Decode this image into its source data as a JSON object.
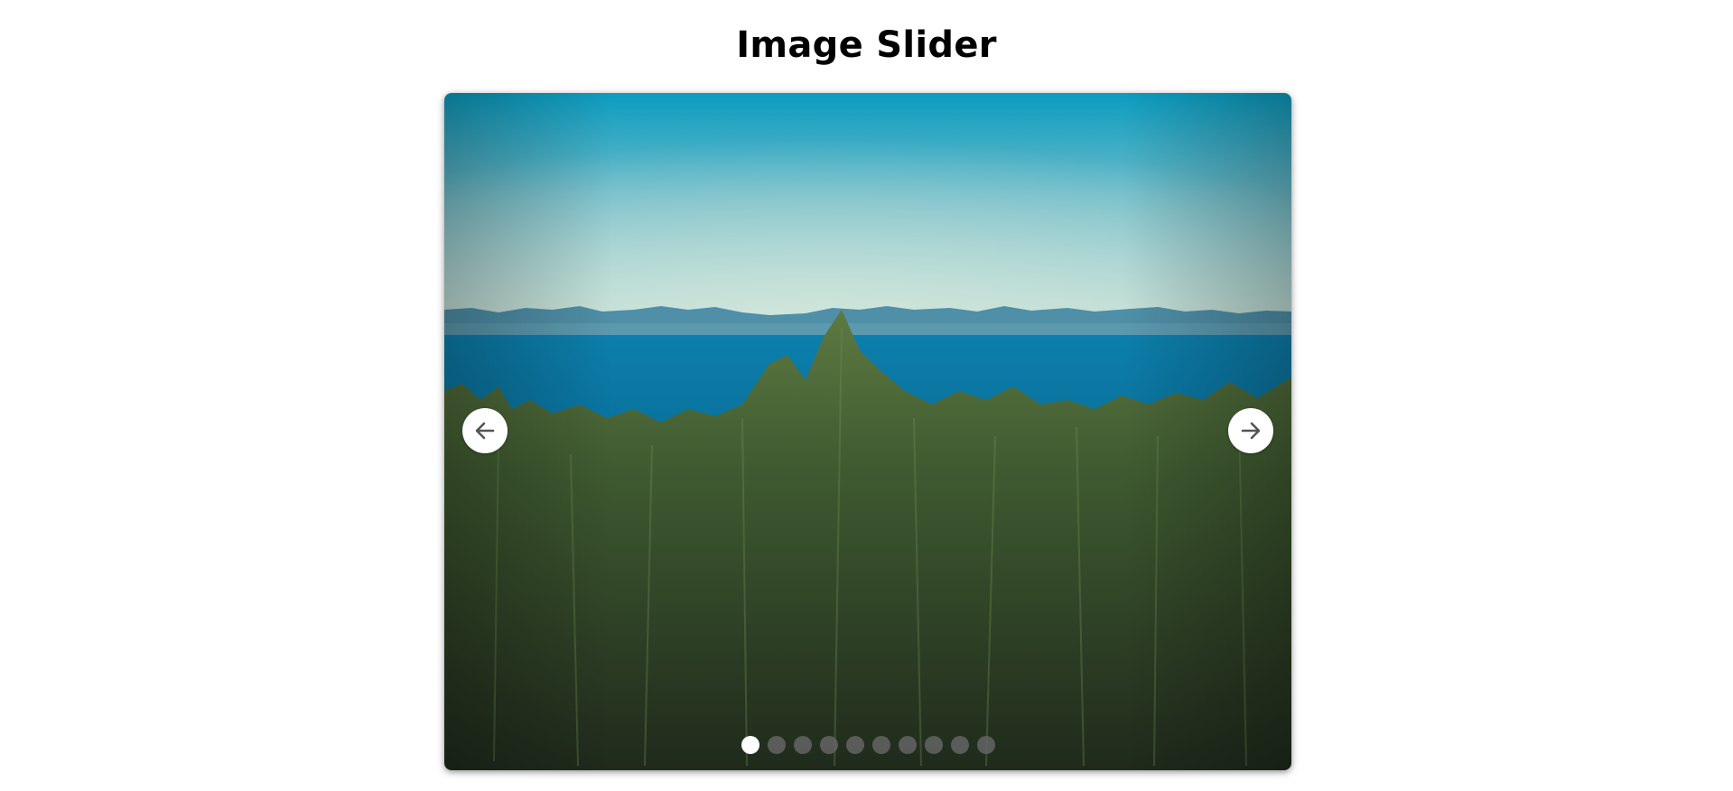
{
  "page": {
    "title": "Image Slider"
  },
  "slider": {
    "current_index": 0,
    "slide_count": 10,
    "image": {
      "description_icon": "landscape-photo-icon"
    },
    "prev_icon": "arrow-left-icon",
    "next_icon": "arrow-right-icon"
  },
  "colors": {
    "background": "#ffffff",
    "dot_active": "#ffffff",
    "dot_inactive": "#646464",
    "sky_top": "#0f9ec0",
    "sky_bottom": "#bcdcd2",
    "sea": "#0a78a6",
    "forest": "#2b3a24"
  }
}
